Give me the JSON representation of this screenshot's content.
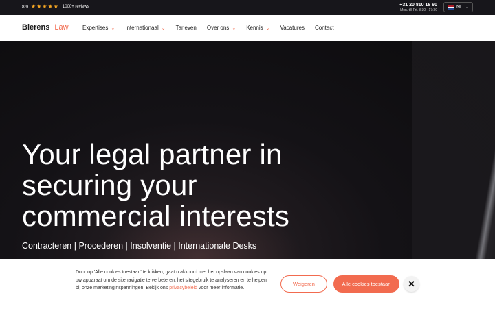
{
  "topbar": {
    "rating_score": "8.9",
    "stars": [
      "★",
      "★",
      "★",
      "★",
      "★"
    ],
    "reviews": "1000+ reviews",
    "phone": "+31 20 810 18 60",
    "hours": "Mon. till Fri. 8:30 - 17:30",
    "language": "NL",
    "flag_colors": [
      "#ae1c28",
      "#ffffff",
      "#21468b"
    ]
  },
  "brand": {
    "logo_name": "Bierens",
    "logo_law": "Law",
    "accent": "#f26b4f"
  },
  "nav": {
    "items": [
      {
        "label": "Expertises",
        "has_dropdown": true
      },
      {
        "label": "Internationaal",
        "has_dropdown": true
      },
      {
        "label": "Tarieven",
        "has_dropdown": false
      },
      {
        "label": "Over ons",
        "has_dropdown": true
      },
      {
        "label": "Kennis",
        "has_dropdown": true
      },
      {
        "label": "Vacatures",
        "has_dropdown": false
      },
      {
        "label": "Contact",
        "has_dropdown": false
      }
    ]
  },
  "hero": {
    "headline": "Your legal partner in securing your commercial interests",
    "subline": "Contracteren | Procederen | Insolventie | Internationale Desks"
  },
  "cookie": {
    "text_before": "Door op 'Alle cookies toestaan' te klikken, gaat u akkoord met het opslaan van cookies op uw apparaat om de sitenavigatie te verbeteren, het sitegebruik te analyseren en te helpen bij onze marketinginspanningen. Bekijk ons ",
    "link": "privacybeleid",
    "text_after": " voor meer informatie.",
    "refuse_label": "Weigeren",
    "accept_label": "Alle cookies toestaan",
    "close_icon": "✕"
  }
}
